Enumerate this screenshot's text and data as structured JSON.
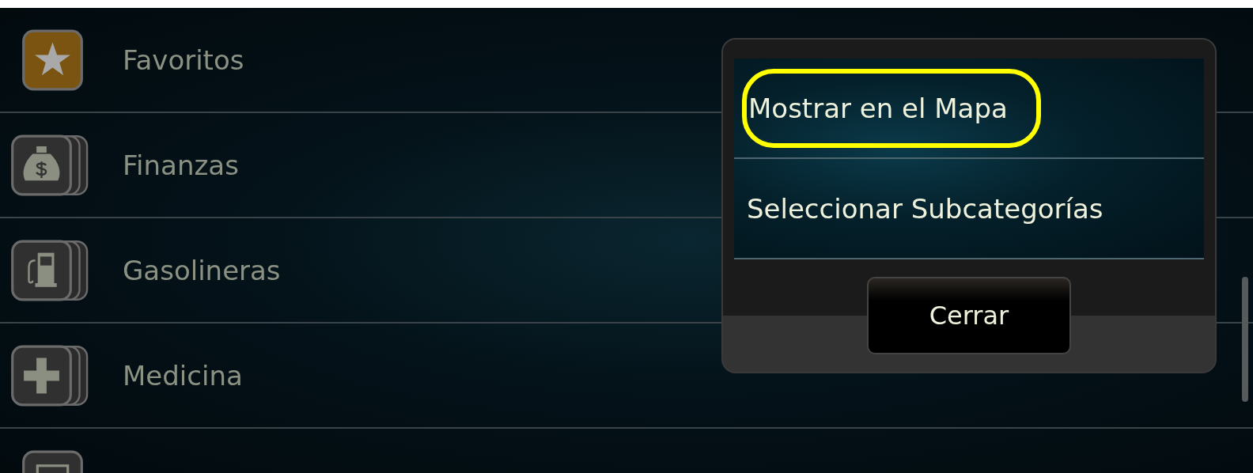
{
  "categories": [
    {
      "label": "Favoritos",
      "kind": "star",
      "stacked": false
    },
    {
      "label": "Finanzas",
      "kind": "money",
      "stacked": true
    },
    {
      "label": "Gasolineras",
      "kind": "fuel",
      "stacked": true
    },
    {
      "label": "Medicina",
      "kind": "cross",
      "stacked": true
    },
    {
      "kind": "generic",
      "stacked": false
    }
  ],
  "popup": {
    "items": [
      {
        "label": "Mostrar en el Mapa",
        "highlighted": true
      },
      {
        "label": "Seleccionar Subcategorías",
        "highlighted": false
      }
    ],
    "close_button": "Cerrar"
  }
}
